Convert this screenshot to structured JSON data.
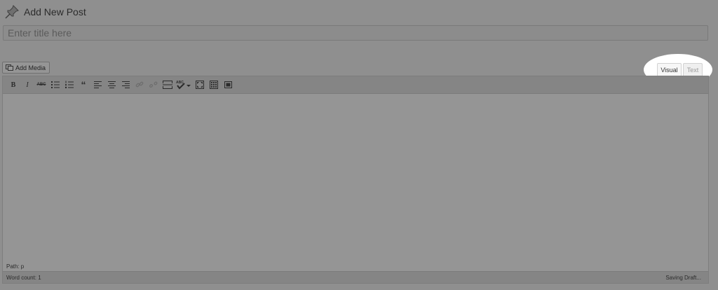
{
  "header": {
    "icon": "pushpin-icon",
    "title": "Add New Post"
  },
  "title_field": {
    "placeholder": "Enter title here",
    "value": ""
  },
  "media": {
    "add_media_label": "Add Media",
    "icon": "media-icon"
  },
  "editor_tabs": [
    {
      "label": "Visual",
      "active": true
    },
    {
      "label": "Text",
      "active": false
    }
  ],
  "toolbar": {
    "bold": "B",
    "italic": "I",
    "strikethrough": "ABC",
    "blockquote": "“",
    "spellcheck": "ABC",
    "buttons": [
      "bold",
      "italic",
      "strikethrough",
      "bullet-list",
      "numbered-list",
      "blockquote",
      "align-left",
      "align-center",
      "align-right",
      "insert-link",
      "remove-link",
      "insert-more",
      "spellcheck",
      "fullscreen",
      "toolbar-toggle",
      "distraction-free"
    ]
  },
  "path": {
    "label": "Path:",
    "value": "p"
  },
  "status": {
    "word_count_label": "Word count:",
    "word_count": "1",
    "save_status": "Saving Draft..."
  },
  "colors": {
    "overlay": "#8f8f8f",
    "highlight": "#ffffff"
  }
}
